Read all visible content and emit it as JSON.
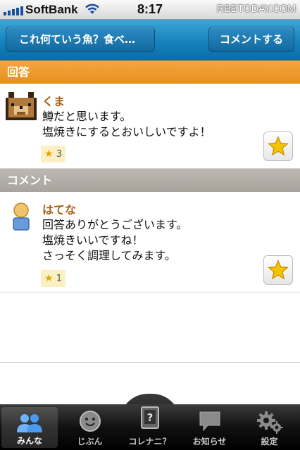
{
  "status_bar": {
    "carrier": "SoftBank",
    "time": "8:17",
    "watermark": "RBBTODAY.COM"
  },
  "nav": {
    "back_label": "これ何ていう魚？食べ…",
    "comment_button": "コメントする"
  },
  "answer_section": {
    "header": "回答",
    "entry": {
      "username": "くま",
      "lines": [
        "鱒だと思います。",
        "塩焼きにするとおいしいですよ！"
      ],
      "star_count": "3"
    }
  },
  "comment_section": {
    "header": "コメント",
    "entry": {
      "username": "はてな",
      "lines": [
        "回答ありがとうございます。",
        "塩焼きいいですね！",
        "さっそく調理してみます。"
      ],
      "star_count": "1"
    }
  },
  "tab_bar": {
    "tabs": [
      {
        "label": "みんな",
        "icon": "people-icon",
        "active": true
      },
      {
        "label": "じぶん",
        "icon": "face-icon",
        "active": false
      },
      {
        "label": "コレナニ？",
        "icon": "question-icon",
        "active": false
      },
      {
        "label": "お知らせ",
        "icon": "speech-bubble-icon",
        "active": false
      },
      {
        "label": "設定",
        "icon": "gear-icon",
        "active": false
      }
    ]
  },
  "colors": {
    "nav_blue": "#1583bd",
    "answer_orange": "#e88f1e",
    "comment_gray": "#a8a49d",
    "username_brown": "#a85c11",
    "star_gold": "#f5c400"
  }
}
